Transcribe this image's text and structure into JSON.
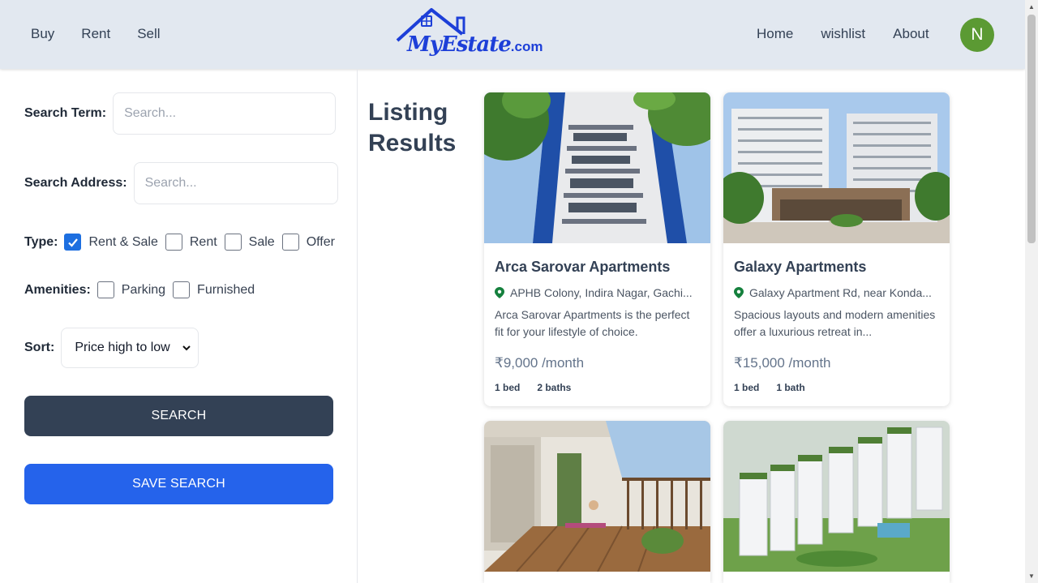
{
  "header": {
    "nav_left": [
      "Buy",
      "Rent",
      "Sell"
    ],
    "nav_right": [
      "Home",
      "wishlist",
      "About"
    ],
    "logo_text": "MyEstate",
    "logo_suffix": ".com",
    "avatar_initial": "N",
    "avatar_color": "#5b9a33"
  },
  "sidebar": {
    "search_term_label": "Search Term:",
    "search_term_placeholder": "Search...",
    "search_address_label": "Search Address:",
    "search_address_placeholder": "Search...",
    "type_label": "Type:",
    "type_options": [
      {
        "label": "Rent & Sale",
        "checked": true
      },
      {
        "label": "Rent",
        "checked": false
      },
      {
        "label": "Sale",
        "checked": false
      },
      {
        "label": "Offer",
        "checked": false
      }
    ],
    "amenities_label": "Amenities:",
    "amenity_options": [
      {
        "label": "Parking",
        "checked": false
      },
      {
        "label": "Furnished",
        "checked": false
      }
    ],
    "sort_label": "Sort:",
    "sort_selected": "Price high to low",
    "search_button": "SEARCH",
    "save_search_button": "SAVE SEARCH"
  },
  "main": {
    "title_line1": "Listing",
    "title_line2": "Results",
    "listings": [
      {
        "title": "Arca Sarovar Apartments",
        "address": "APHB Colony, Indira Nagar, Gachi...",
        "description": "Arca Sarovar Apartments is the perfect fit for your lifestyle of choice.",
        "price": "₹9,000 /month",
        "beds": "1 bed",
        "baths": "2 baths"
      },
      {
        "title": "Galaxy Apartments",
        "address": "Galaxy Apartment Rd, near Konda...",
        "description": "Spacious layouts and modern amenities offer a luxurious retreat in...",
        "price": "₹15,000 /month",
        "beds": "1 bed",
        "baths": "1 bath"
      },
      {
        "title": "",
        "address": "",
        "description": "",
        "price": "",
        "beds": "",
        "baths": ""
      },
      {
        "title": "",
        "address": "",
        "description": "",
        "price": "",
        "beds": "",
        "baths": ""
      }
    ]
  },
  "colors": {
    "header_bg": "#e2e8f0",
    "search_button": "#334155",
    "save_button": "#2563eb",
    "checkbox_checked": "#1d6fe0",
    "pin": "#15803d"
  }
}
